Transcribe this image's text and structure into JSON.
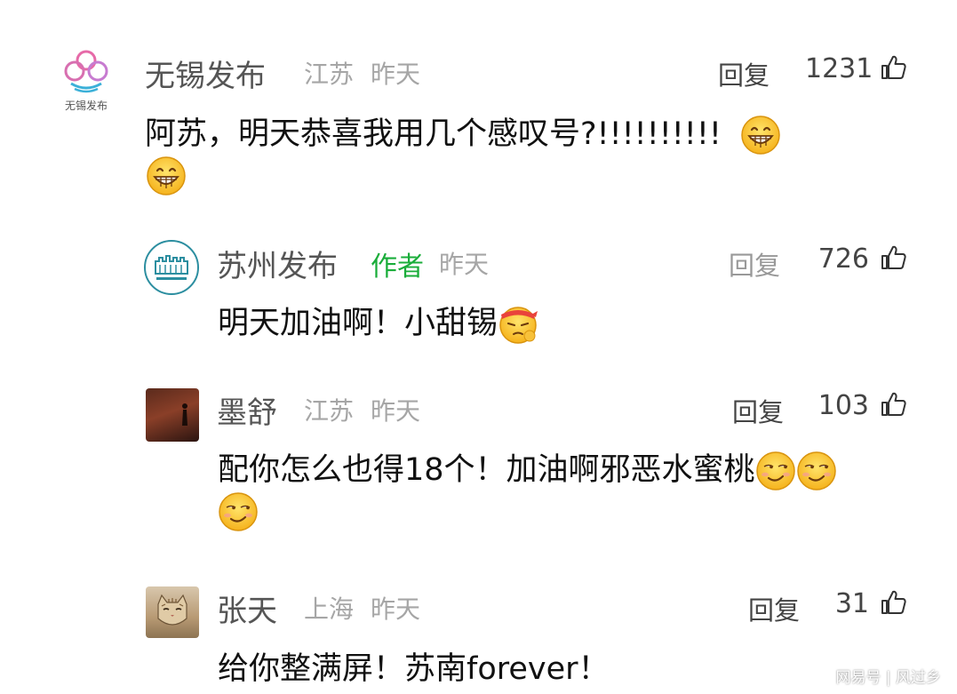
{
  "colors": {
    "author_tag": "#1aad3a",
    "name": "#555555",
    "meta": "#a6a6a6",
    "text": "#111111"
  },
  "comments": [
    {
      "name": "无锡发布",
      "location": "江苏",
      "time": "昨天",
      "reply": "回复",
      "likes": "1231",
      "avatar_caption": "无锡发布",
      "text": "阿苏，明天恭喜我用几个感叹号?!!!!!!!!!!",
      "emojis": [
        "grin-emoji",
        "grin-emoji"
      ]
    },
    {
      "name": "苏州发布",
      "author_tag": "作者",
      "time": "昨天",
      "reply": "回复",
      "likes": "726",
      "text": "明天加油啊！小甜锡",
      "emojis": [
        "cheer-emoji"
      ]
    },
    {
      "name": "墨舒",
      "location": "江苏",
      "time": "昨天",
      "reply": "回复",
      "likes": "103",
      "text": "配你怎么也得18个！加油啊邪恶水蜜桃",
      "emojis": [
        "smirk-emoji",
        "smirk-emoji",
        "smirk-emoji"
      ]
    },
    {
      "name": "张天",
      "location": "上海",
      "time": "昨天",
      "reply": "回复",
      "likes": "31",
      "text": "给你整满屏！苏南forever！"
    }
  ],
  "watermark": "网易号 | 风过乡"
}
